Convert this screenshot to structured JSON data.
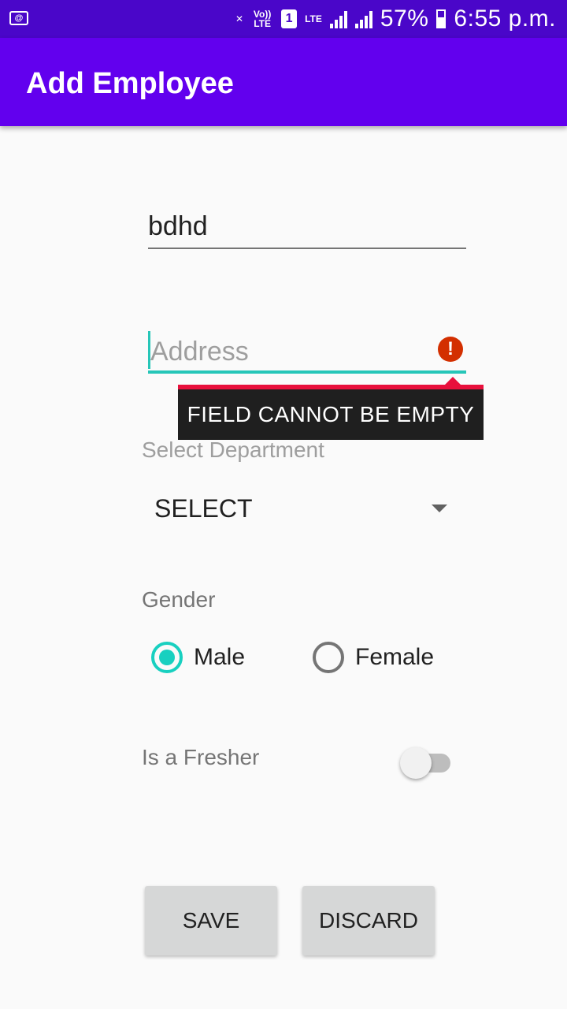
{
  "status_bar": {
    "volte_label": "Vo)) LTE",
    "sim_slot": "1",
    "network_label": "LTE",
    "battery_percent": "57%",
    "time": "6:55 p.m.",
    "battery_level": 0.57
  },
  "app_bar": {
    "title": "Add Employee"
  },
  "form": {
    "name_value": "bdhd",
    "address_placeholder": "Address",
    "address_error": "FIELD CANNOT BE EMPTY",
    "department_label": "Select Department",
    "department_selected": "SELECT",
    "gender_label": "Gender",
    "gender_options": [
      {
        "label": "Male",
        "checked": true
      },
      {
        "label": "Female",
        "checked": false
      }
    ],
    "fresher_label": "Is a Fresher",
    "fresher_on": false
  },
  "actions": {
    "save_label": "SAVE",
    "discard_label": "DISCARD"
  },
  "colors": {
    "status_bar": "#4a06c9",
    "app_bar": "#6200ee",
    "accent": "#18d0c0",
    "error": "#e8103c"
  }
}
